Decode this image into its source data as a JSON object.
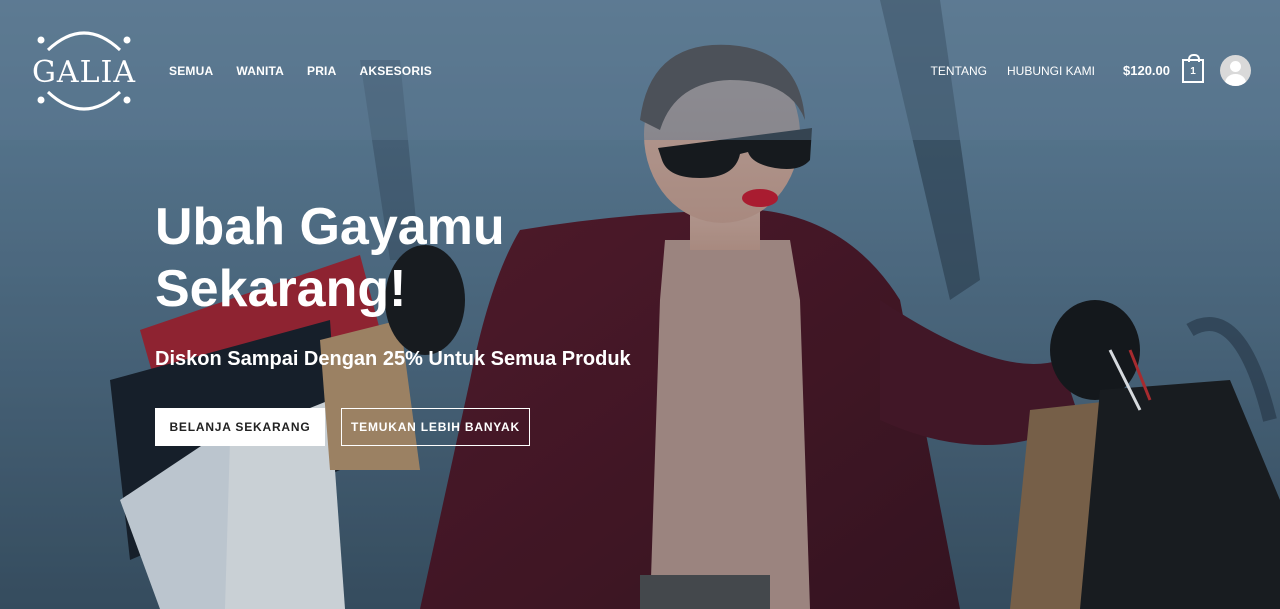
{
  "brand": {
    "logo_text": "GALIA"
  },
  "nav": {
    "left": [
      {
        "label": "SEMUA"
      },
      {
        "label": "WANITA"
      },
      {
        "label": "PRIA"
      },
      {
        "label": "AKSESORIS"
      }
    ],
    "right": [
      {
        "label": "TENTANG"
      },
      {
        "label": "HUBUNGI KAMI"
      }
    ]
  },
  "cart": {
    "price": "$120.00",
    "count": "1",
    "icon": "shopping-bag-icon"
  },
  "account": {
    "icon": "user-avatar-icon"
  },
  "hero": {
    "headline": "Ubah Gayamu Sekarang!",
    "subheadline": "Diskon Sampai Dengan 25% Untuk Semua Produk",
    "primary_button": "BELANJA SEKARANG",
    "secondary_button": "TEMUKAN LEBIH BANYAK"
  },
  "colors": {
    "text": "#ffffff",
    "primary_button_bg": "#ffffff",
    "primary_button_text": "#222222"
  }
}
